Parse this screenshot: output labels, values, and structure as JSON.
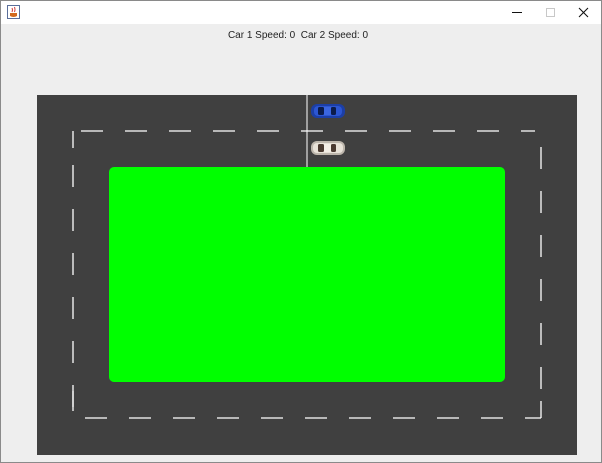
{
  "window": {
    "title_icon": "java-cup-icon",
    "controls": {
      "minimize_icon": "minimize-icon",
      "maximize_icon": "maximize-icon",
      "close_icon": "close-icon"
    }
  },
  "hud": {
    "car1_label": "Car 1 Speed:",
    "car1_speed": 0,
    "car2_label": "Car 2 Speed:",
    "car2_speed": 0,
    "text": "Car 1 Speed: 0  Car 2 Speed: 0"
  },
  "track": {
    "asphalt_color": "#404040",
    "infield_color": "#00ff00",
    "lane_marking_color": "#ffffff",
    "start_line_color": "#ffffff"
  },
  "cars": [
    {
      "name": "Car 1",
      "color": "#1c3fa6",
      "lane": "outer",
      "heading": "east"
    },
    {
      "name": "Car 2",
      "color": "#e8e2d8",
      "lane": "inner",
      "heading": "east"
    }
  ]
}
